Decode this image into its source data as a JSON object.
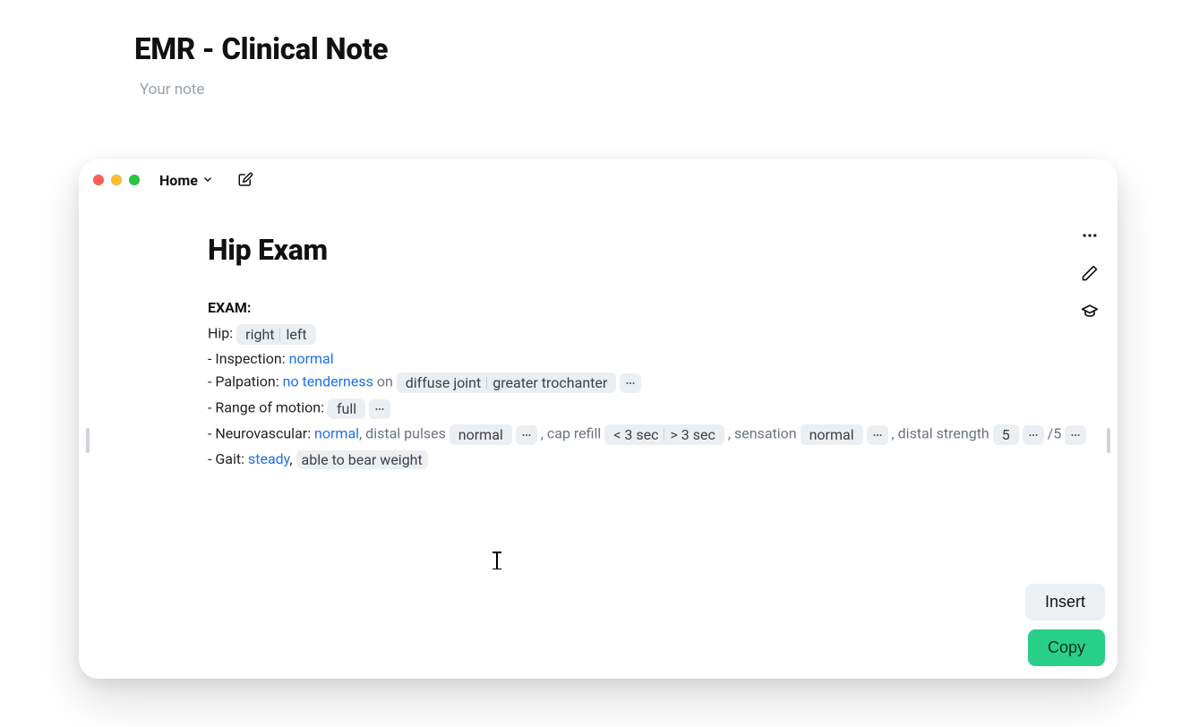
{
  "header": {
    "title": "EMR - Clinical Note",
    "subtitle": "Your note"
  },
  "panel": {
    "nav_label": "Home",
    "doc_title": "Hip Exam",
    "section_heading": "EXAM:",
    "lines": {
      "hip": {
        "label": "Hip:",
        "options": [
          "right",
          "left"
        ]
      },
      "inspection": {
        "label": "- Inspection:",
        "value": "normal"
      },
      "palpation": {
        "label": "- Palpation:",
        "value": "no tenderness",
        "on": "on",
        "area_options": [
          "diffuse joint",
          "greater trochanter"
        ]
      },
      "rom": {
        "label": "- Range of motion:",
        "value": "full"
      },
      "neuro": {
        "label": "- Neurovascular:",
        "overall": "normal",
        "distal_pulses_label": ", distal pulses",
        "distal_pulses_value": "normal",
        "cap_refill_label": ", cap refill",
        "cap_refill_options": [
          "< 3 sec",
          "> 3 sec"
        ],
        "sensation_label": ", sensation",
        "sensation_value": "normal",
        "distal_strength_label": ", distal strength",
        "distal_strength_value": "5",
        "distal_strength_denom": "/5"
      },
      "gait": {
        "label": "- Gait:",
        "value": "steady",
        "chip": "able to bear weight"
      }
    },
    "actions": {
      "insert": "Insert",
      "copy": "Copy"
    }
  }
}
